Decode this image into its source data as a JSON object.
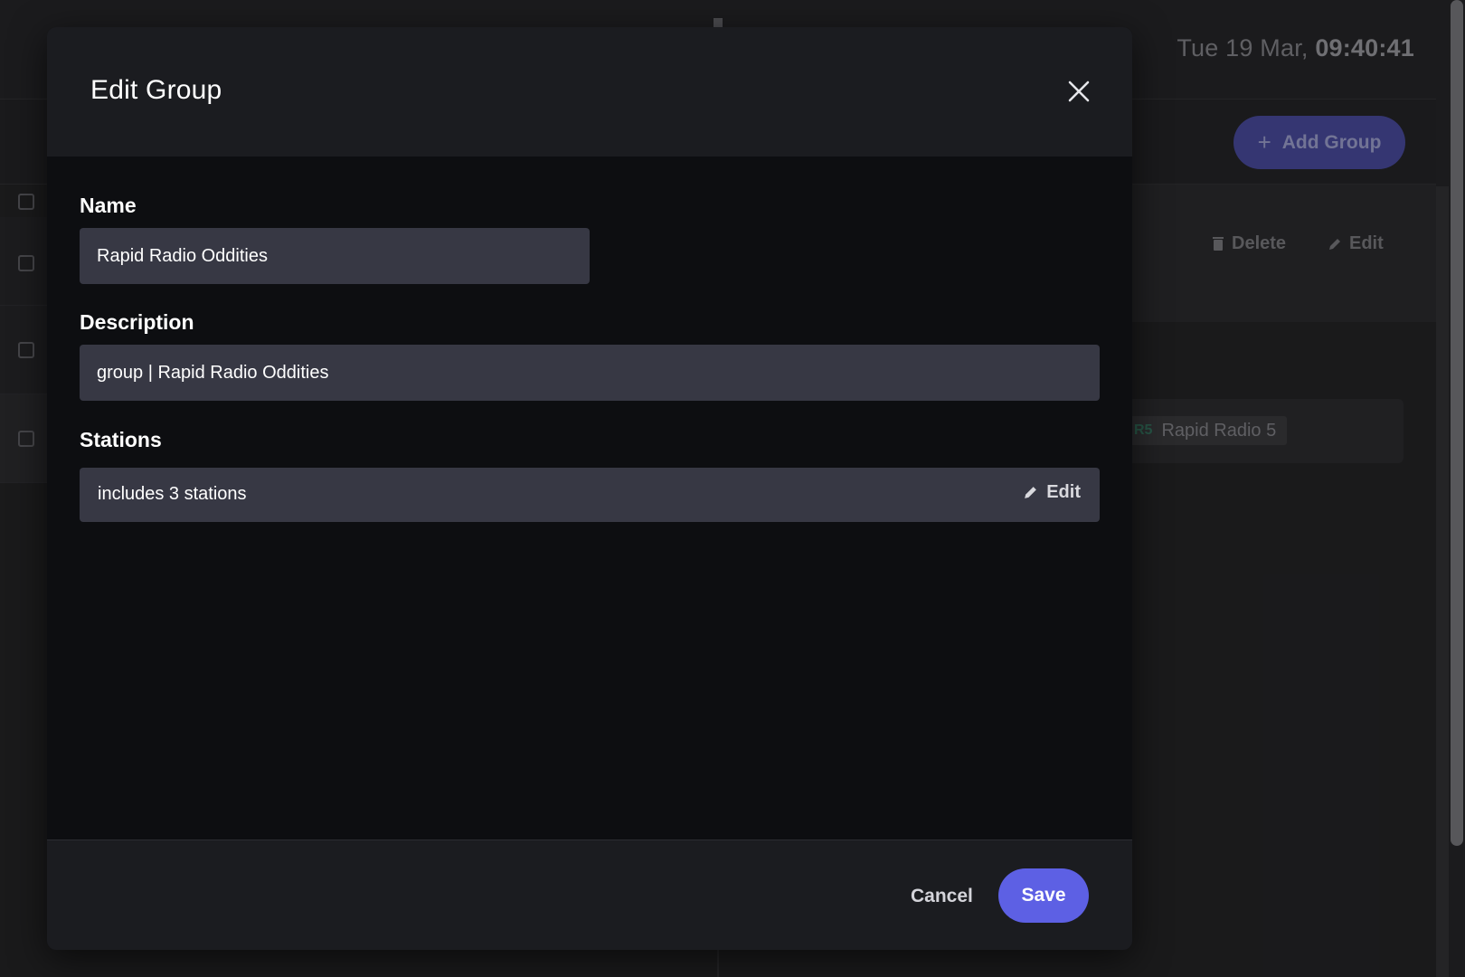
{
  "background": {
    "clock": {
      "date": "Tue 19 Mar,",
      "time": "09:40:41"
    },
    "add_group_label": "Add Group",
    "actions": {
      "delete_label": "Delete",
      "edit_label": "Edit"
    },
    "station_chip": {
      "badge": "R5",
      "name": "Rapid Radio 5"
    }
  },
  "modal": {
    "title": "Edit Group",
    "close_icon": "close-icon",
    "fields": {
      "name": {
        "label": "Name",
        "value": "Rapid Radio Oddities"
      },
      "description": {
        "label": "Description",
        "value": "group | Rapid Radio Oddities"
      },
      "stations": {
        "label": "Stations",
        "summary": "includes 3 stations",
        "edit_label": "Edit"
      }
    },
    "footer": {
      "cancel_label": "Cancel",
      "save_label": "Save"
    }
  },
  "colors": {
    "accent": "#5d60e4",
    "modal_bg": "#0d0e11",
    "modal_header_bg": "#1b1c20",
    "input_bg": "#373844"
  }
}
